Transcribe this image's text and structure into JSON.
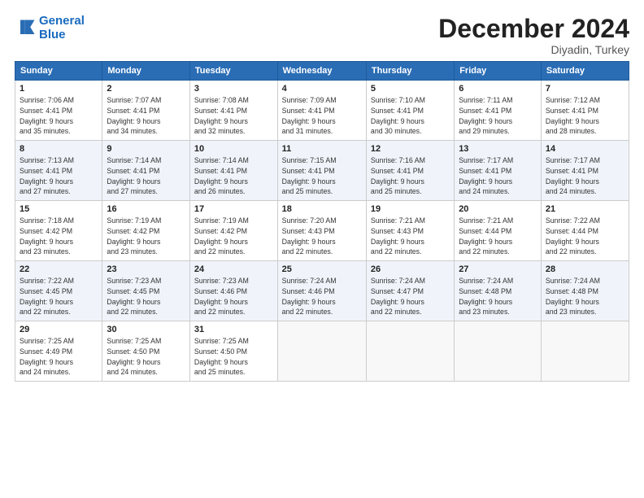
{
  "logo": {
    "line1": "General",
    "line2": "Blue"
  },
  "title": "December 2024",
  "subtitle": "Diyadin, Turkey",
  "days_of_week": [
    "Sunday",
    "Monday",
    "Tuesday",
    "Wednesday",
    "Thursday",
    "Friday",
    "Saturday"
  ],
  "weeks": [
    [
      {
        "day": "1",
        "info": "Sunrise: 7:06 AM\nSunset: 4:41 PM\nDaylight: 9 hours\nand 35 minutes."
      },
      {
        "day": "2",
        "info": "Sunrise: 7:07 AM\nSunset: 4:41 PM\nDaylight: 9 hours\nand 34 minutes."
      },
      {
        "day": "3",
        "info": "Sunrise: 7:08 AM\nSunset: 4:41 PM\nDaylight: 9 hours\nand 32 minutes."
      },
      {
        "day": "4",
        "info": "Sunrise: 7:09 AM\nSunset: 4:41 PM\nDaylight: 9 hours\nand 31 minutes."
      },
      {
        "day": "5",
        "info": "Sunrise: 7:10 AM\nSunset: 4:41 PM\nDaylight: 9 hours\nand 30 minutes."
      },
      {
        "day": "6",
        "info": "Sunrise: 7:11 AM\nSunset: 4:41 PM\nDaylight: 9 hours\nand 29 minutes."
      },
      {
        "day": "7",
        "info": "Sunrise: 7:12 AM\nSunset: 4:41 PM\nDaylight: 9 hours\nand 28 minutes."
      }
    ],
    [
      {
        "day": "8",
        "info": "Sunrise: 7:13 AM\nSunset: 4:41 PM\nDaylight: 9 hours\nand 27 minutes."
      },
      {
        "day": "9",
        "info": "Sunrise: 7:14 AM\nSunset: 4:41 PM\nDaylight: 9 hours\nand 27 minutes."
      },
      {
        "day": "10",
        "info": "Sunrise: 7:14 AM\nSunset: 4:41 PM\nDaylight: 9 hours\nand 26 minutes."
      },
      {
        "day": "11",
        "info": "Sunrise: 7:15 AM\nSunset: 4:41 PM\nDaylight: 9 hours\nand 25 minutes."
      },
      {
        "day": "12",
        "info": "Sunrise: 7:16 AM\nSunset: 4:41 PM\nDaylight: 9 hours\nand 25 minutes."
      },
      {
        "day": "13",
        "info": "Sunrise: 7:17 AM\nSunset: 4:41 PM\nDaylight: 9 hours\nand 24 minutes."
      },
      {
        "day": "14",
        "info": "Sunrise: 7:17 AM\nSunset: 4:41 PM\nDaylight: 9 hours\nand 24 minutes."
      }
    ],
    [
      {
        "day": "15",
        "info": "Sunrise: 7:18 AM\nSunset: 4:42 PM\nDaylight: 9 hours\nand 23 minutes."
      },
      {
        "day": "16",
        "info": "Sunrise: 7:19 AM\nSunset: 4:42 PM\nDaylight: 9 hours\nand 23 minutes."
      },
      {
        "day": "17",
        "info": "Sunrise: 7:19 AM\nSunset: 4:42 PM\nDaylight: 9 hours\nand 22 minutes."
      },
      {
        "day": "18",
        "info": "Sunrise: 7:20 AM\nSunset: 4:43 PM\nDaylight: 9 hours\nand 22 minutes."
      },
      {
        "day": "19",
        "info": "Sunrise: 7:21 AM\nSunset: 4:43 PM\nDaylight: 9 hours\nand 22 minutes."
      },
      {
        "day": "20",
        "info": "Sunrise: 7:21 AM\nSunset: 4:44 PM\nDaylight: 9 hours\nand 22 minutes."
      },
      {
        "day": "21",
        "info": "Sunrise: 7:22 AM\nSunset: 4:44 PM\nDaylight: 9 hours\nand 22 minutes."
      }
    ],
    [
      {
        "day": "22",
        "info": "Sunrise: 7:22 AM\nSunset: 4:45 PM\nDaylight: 9 hours\nand 22 minutes."
      },
      {
        "day": "23",
        "info": "Sunrise: 7:23 AM\nSunset: 4:45 PM\nDaylight: 9 hours\nand 22 minutes."
      },
      {
        "day": "24",
        "info": "Sunrise: 7:23 AM\nSunset: 4:46 PM\nDaylight: 9 hours\nand 22 minutes."
      },
      {
        "day": "25",
        "info": "Sunrise: 7:24 AM\nSunset: 4:46 PM\nDaylight: 9 hours\nand 22 minutes."
      },
      {
        "day": "26",
        "info": "Sunrise: 7:24 AM\nSunset: 4:47 PM\nDaylight: 9 hours\nand 22 minutes."
      },
      {
        "day": "27",
        "info": "Sunrise: 7:24 AM\nSunset: 4:48 PM\nDaylight: 9 hours\nand 23 minutes."
      },
      {
        "day": "28",
        "info": "Sunrise: 7:24 AM\nSunset: 4:48 PM\nDaylight: 9 hours\nand 23 minutes."
      }
    ],
    [
      {
        "day": "29",
        "info": "Sunrise: 7:25 AM\nSunset: 4:49 PM\nDaylight: 9 hours\nand 24 minutes."
      },
      {
        "day": "30",
        "info": "Sunrise: 7:25 AM\nSunset: 4:50 PM\nDaylight: 9 hours\nand 24 minutes."
      },
      {
        "day": "31",
        "info": "Sunrise: 7:25 AM\nSunset: 4:50 PM\nDaylight: 9 hours\nand 25 minutes."
      },
      null,
      null,
      null,
      null
    ]
  ]
}
